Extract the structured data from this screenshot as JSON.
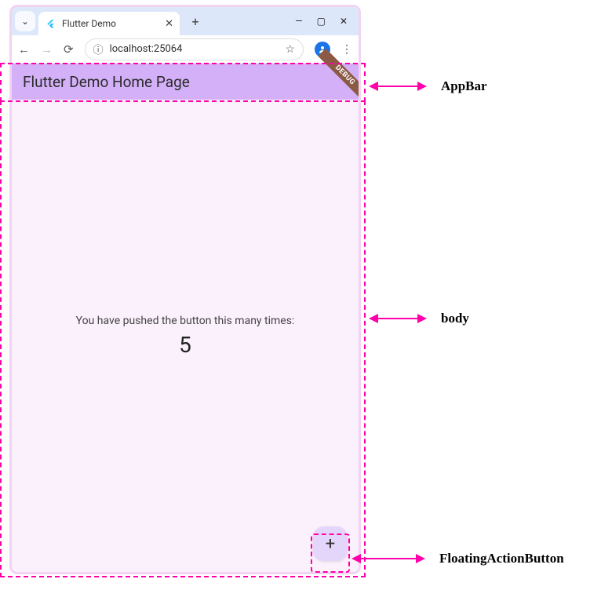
{
  "browser": {
    "tab_title": "Flutter Demo",
    "address": "localhost:25064"
  },
  "app": {
    "appbar_title": "Flutter Demo Home Page",
    "debug_label": "DEBUG",
    "body_text": "You have pushed the button this many times:",
    "counter": "5",
    "fab_glyph": "+"
  },
  "annotations": {
    "appbar": "AppBar",
    "body": "body",
    "fab": "FloatingActionButton"
  }
}
